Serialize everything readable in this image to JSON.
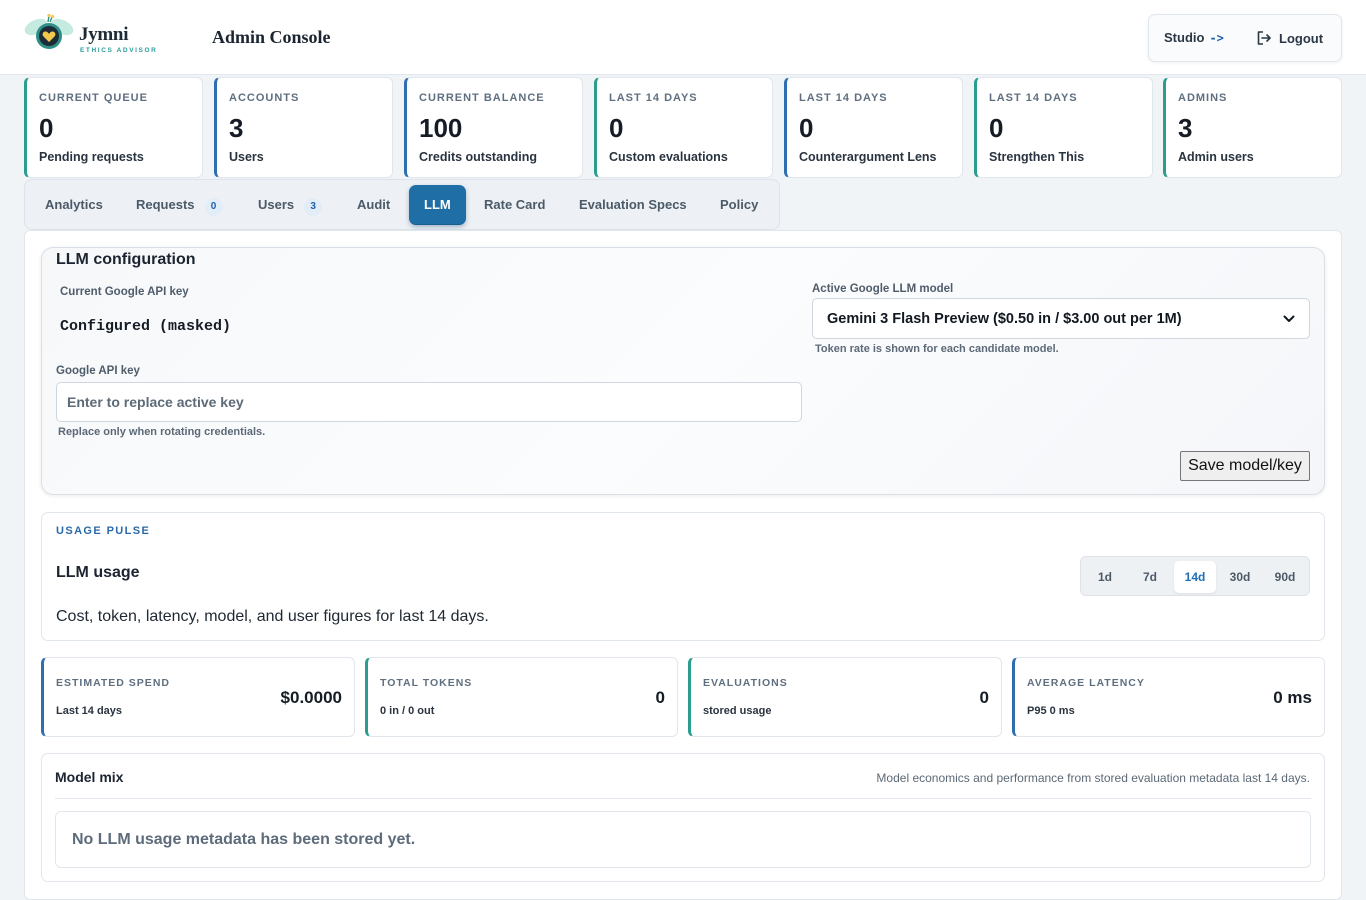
{
  "brand": {
    "name": "Jymni",
    "tagline": "ETHICS ADVISOR"
  },
  "header": {
    "title": "Admin Console",
    "studio_label": "Studio",
    "studio_arrow": "->",
    "logout_label": "Logout"
  },
  "stats": [
    {
      "label": "CURRENT QUEUE",
      "value": "0",
      "sub": "Pending requests"
    },
    {
      "label": "ACCOUNTS",
      "value": "3",
      "sub": "Users"
    },
    {
      "label": "CURRENT BALANCE",
      "value": "100",
      "sub": "Credits outstanding"
    },
    {
      "label": "LAST 14 DAYS",
      "value": "0",
      "sub": "Custom evaluations"
    },
    {
      "label": "LAST 14 DAYS",
      "value": "0",
      "sub": "Counterargument Lens"
    },
    {
      "label": "LAST 14 DAYS",
      "value": "0",
      "sub": "Strengthen This"
    },
    {
      "label": "ADMINS",
      "value": "3",
      "sub": "Admin users"
    }
  ],
  "tabs": [
    {
      "label": "Analytics"
    },
    {
      "label": "Requests",
      "count": "0"
    },
    {
      "label": "Users",
      "count": "3"
    },
    {
      "label": "Audit"
    },
    {
      "label": "LLM",
      "active": true
    },
    {
      "label": "Rate Card"
    },
    {
      "label": "Evaluation Specs"
    },
    {
      "label": "Policy"
    }
  ],
  "llm_config": {
    "title": "LLM configuration",
    "current_key_label": "Current Google API key",
    "current_key_status": "Configured (masked)",
    "api_key_label": "Google API key",
    "api_key_placeholder": "Enter to replace active key",
    "api_key_value": "",
    "api_key_help": "Replace only when rotating credentials.",
    "model_label": "Active Google LLM model",
    "model_selected": "Gemini 3 Flash Preview ($0.50 in / $3.00 out per 1M)",
    "model_help": "Token rate is shown for each candidate model.",
    "save_label": "Save model/key"
  },
  "usage": {
    "eyebrow": "USAGE PULSE",
    "title": "LLM usage",
    "description": "Cost, token, latency, model, and user figures for last 14 days.",
    "ranges": [
      "1d",
      "7d",
      "14d",
      "30d",
      "90d"
    ],
    "active_range": "14d"
  },
  "metrics": [
    {
      "label": "ESTIMATED SPEND",
      "sub": "Last 14 days",
      "value": "$0.0000"
    },
    {
      "label": "TOTAL TOKENS",
      "sub": "0 in / 0 out",
      "value": "0"
    },
    {
      "label": "EVALUATIONS",
      "sub": "stored usage",
      "value": "0"
    },
    {
      "label": "AVERAGE LATENCY",
      "sub": "P95 0 ms",
      "value": "0 ms"
    }
  ],
  "model_mix": {
    "title": "Model mix",
    "description": "Model economics and performance from stored evaluation metadata last 14 days.",
    "empty_message": "No LLM usage metadata has been stored yet."
  },
  "colors": {
    "accent_blue": "#1f6fa6",
    "stat_teal": "#2a9d8f",
    "stat_blue": "#2f6fb0"
  }
}
